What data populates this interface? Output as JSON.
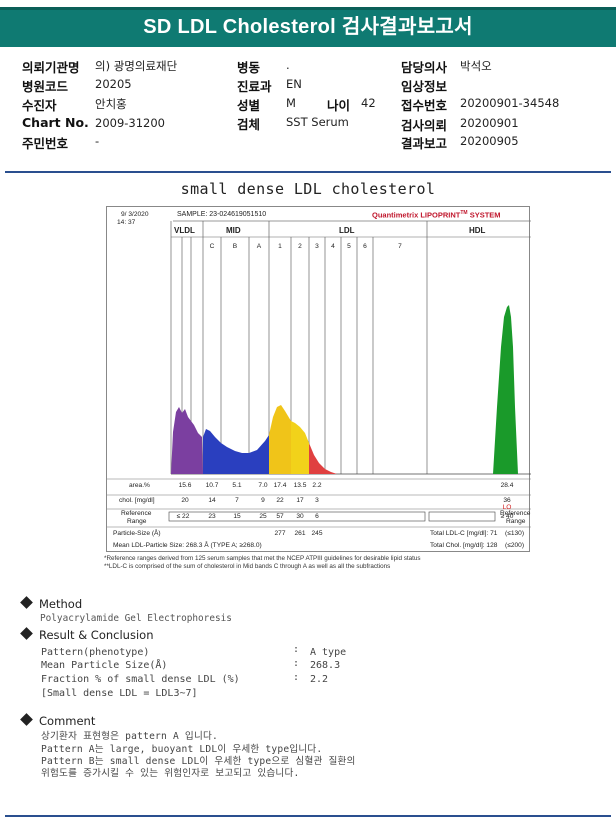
{
  "header": {
    "title": "SD LDL Cholesterol 검사결과보고서"
  },
  "info": {
    "col1": [
      {
        "label": "의뢰기관명",
        "value": "의) 광명의료재단"
      },
      {
        "label": "병원코드",
        "value": "20205"
      },
      {
        "label": "수진자",
        "value": "안치홍"
      },
      {
        "label": "Chart No.",
        "value": "2009-31200"
      },
      {
        "label": "주민번호",
        "value": "-"
      }
    ],
    "col2": [
      {
        "label": "병동",
        "value": "."
      },
      {
        "label": "진료과",
        "value": "EN"
      },
      {
        "label": "성별",
        "value": "M"
      },
      {
        "label": "검체",
        "value": "SST Serum"
      }
    ],
    "age": {
      "label": "나이",
      "value": "42"
    },
    "col3": [
      {
        "label": "담당의사",
        "value": "박석오"
      },
      {
        "label": "임상정보",
        "value": ""
      },
      {
        "label": "접수번호",
        "value": "20200901-34548"
      },
      {
        "label": "검사의뢰",
        "value": "20200901"
      },
      {
        "label": "결과보고",
        "value": "20200905"
      }
    ]
  },
  "report_title": "small dense LDL cholesterol",
  "panel": {
    "date": "9/ 3/2020",
    "time": "14: 37",
    "sample": "SAMPLE:  23-024619051510",
    "brand": "Quantimetrix LIPOPRINT",
    "brand_tm": "TM",
    "brand_suffix": "SYSTEM",
    "bands": {
      "vldl": "VLDL",
      "mid": "MID",
      "ldl": "LDL",
      "hdl": "HDL"
    },
    "subbands": [
      "C",
      "B",
      "A",
      "1",
      "2",
      "3",
      "4",
      "5",
      "6",
      "7"
    ],
    "row_area_label": "area.%",
    "row_chol_label": "chol. [mg/dl]",
    "row_ref_label_1": "Reference",
    "row_ref_label_2": "Range",
    "row_ps_label": "Particle-Size (Å)",
    "row_mean_label": "Mean LDL-Particle Size:   268.3 Å   (TYPE A; ≥268.0)",
    "area": [
      "15.6",
      "10.7",
      "5.1",
      "7.0",
      "17.4",
      "13.5",
      "2.2"
    ],
    "chol": [
      "20",
      "14",
      "7",
      "9",
      "22",
      "17",
      "3"
    ],
    "ref": [
      "≤ 22",
      "23",
      "15",
      "25",
      "57",
      "30",
      "6"
    ],
    "psize": [
      "277",
      "261",
      "245"
    ],
    "hdl_area": "28.4",
    "hdl_chol": "36",
    "hdl_lo": "LO",
    "hdl_ref": "≥ 40",
    "ref_range_right_1": "Reference",
    "ref_range_right_2": "Range",
    "total_ldl_label": "Total LDL-C [mg/dl]:  71",
    "total_ldl_ref": "(≤130)",
    "total_chol_label": "Total Chol. [mg/dl]:   128",
    "total_chol_ref": "(≤200)"
  },
  "footnotes": [
    "*Reference ranges derived from 125 serum samples that met the NCEP ATPIII guidelines for desirable lipid status",
    "**LDL-C is comprised of the sum of cholesterol in Mid bands C through A as well as all the subfractions"
  ],
  "method": {
    "heading": "Method",
    "text": "Polyacrylamide Gel Electrophoresis"
  },
  "result": {
    "heading": "Result & Conclusion",
    "rows": [
      {
        "label": "Pattern(phenotype)",
        "value": "A type"
      },
      {
        "label": "Mean Particle Size(Å)",
        "value": "268.3"
      },
      {
        "label": "Fraction % of small dense LDL (%)",
        "value": "2.2"
      }
    ],
    "note": "[Small dense LDL = LDL3~7]"
  },
  "comment": {
    "heading": "Comment",
    "lines": [
      "상기환자 표현형은 pattern A 입니다.",
      "Pattern A는 large, buoyant LDL이 우세한 type입니다.",
      "Pattern B는 small dense LDL이 우세한 type으로 심혈관 질환의",
      "위험도를 증가시킬 수 있는 위험인자로 보고되고 있습니다."
    ]
  },
  "colors": {
    "header": "#0f7a72",
    "rule": "#2a4f8f",
    "brand": "#c0162c",
    "vldl": "#7b3fa0",
    "mid": "#2a3fbf",
    "ldl1": "#f2d21a",
    "ldl3": "#e04040",
    "hdl": "#1a9a2a"
  }
}
